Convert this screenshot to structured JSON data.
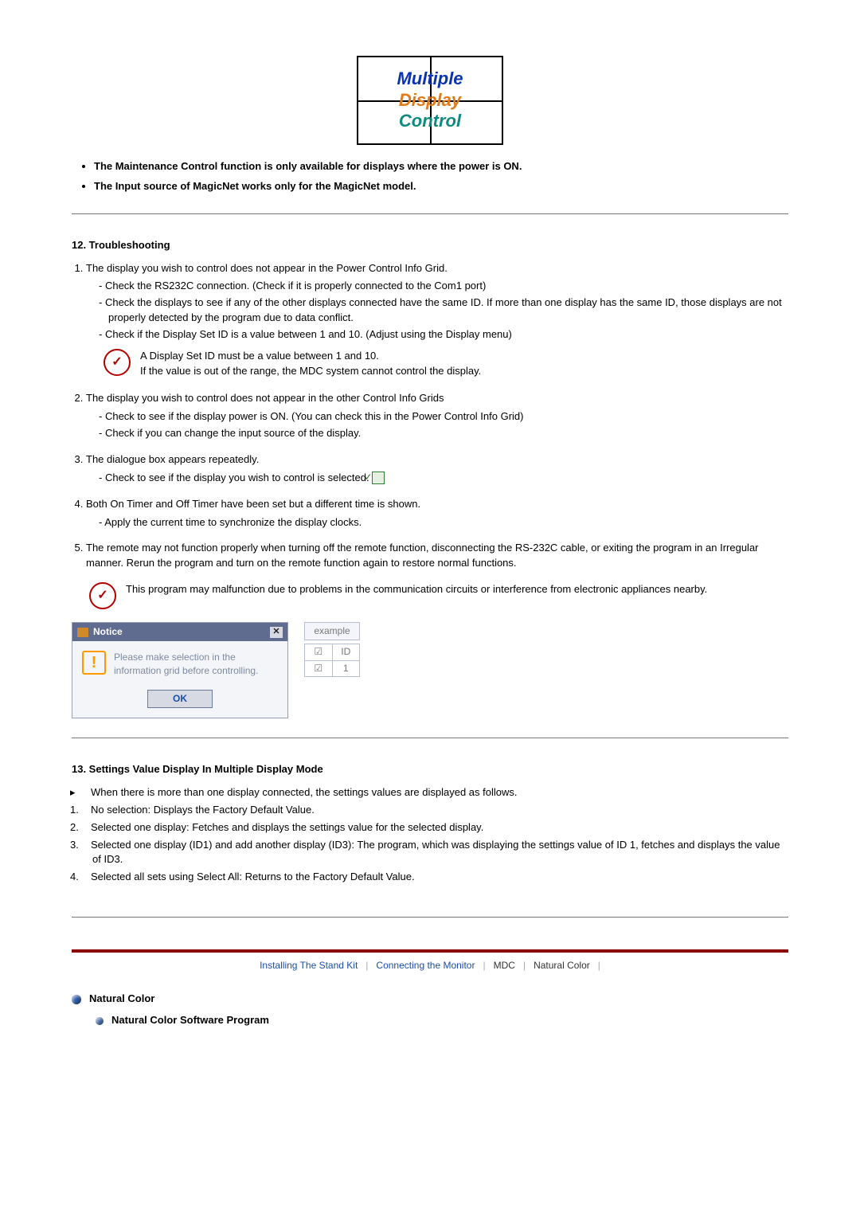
{
  "logo": {
    "w1": "Multiple",
    "w2": "Display",
    "w3": "Control"
  },
  "notes": [
    "The Maintenance Control function is only available for displays where the power is ON.",
    "The Input source of MagicNet works only for the MagicNet model."
  ],
  "section12_title": "12. Troubleshooting",
  "ts1": {
    "head": "The display you wish to control does not appear in the Power Control Info Grid.",
    "items": [
      "Check the RS232C connection. (Check if it is properly connected to the Com1 port)",
      "Check the displays to see if any of the other displays connected have the same ID. If more than one display has the same ID, those displays are not properly detected by the program due to data conflict.",
      "Check if the Display Set ID is a value between 1 and 10. (Adjust using the Display menu)"
    ],
    "tip1": "A Display Set ID must be a value between 1 and 10.",
    "tip2": "If the value is out of the range, the MDC system cannot control the display."
  },
  "ts2": {
    "head": "The display you wish to control does not appear in the other Control Info Grids",
    "items": [
      "Check to see if the display power is ON. (You can check this in the Power Control Info Grid)",
      "Check if you can change the input source of the display."
    ]
  },
  "ts3": {
    "head": "The dialogue box appears repeatedly.",
    "items": [
      "Check to see if the display you wish to control is selected."
    ]
  },
  "ts4": {
    "head": "Both On Timer and Off Timer have been set but a different time is shown.",
    "items": [
      "Apply the current time to synchronize the display clocks."
    ]
  },
  "ts5": {
    "head": "The remote may not function properly when turning off the remote function, disconnecting the RS-232C cable, or exiting the program in an Irregular manner. Rerun the program and turn on the remote function again to restore normal functions."
  },
  "tip_final": "This program may malfunction due to problems in the communication circuits or interference from electronic appliances nearby.",
  "dialog": {
    "title": "Notice",
    "message": "Please make selection in the information grid before controlling.",
    "ok": "OK"
  },
  "example": {
    "label": "example",
    "hdr_id": "ID",
    "row_val": "1"
  },
  "section13_title": "13. Settings Value Display In Multiple Display Mode",
  "s13_lead": "When there is more than one display connected, the settings values are displayed as follows.",
  "s13_items": [
    "No selection: Displays the Factory Default Value.",
    "Selected one display: Fetches and displays the settings value for the selected display.",
    "Selected one display (ID1) and add another display (ID3): The program, which was displaying the settings value of ID 1, fetches and displays the value of ID3.",
    "Selected all sets using Select All: Returns to the Factory Default Value."
  ],
  "breadcrumb": {
    "a": "Installing The Stand Kit",
    "b": "Connecting the Monitor",
    "c": "MDC",
    "d": "Natural Color"
  },
  "nc": {
    "title": "Natural Color",
    "sub": "Natural Color Software Program"
  }
}
